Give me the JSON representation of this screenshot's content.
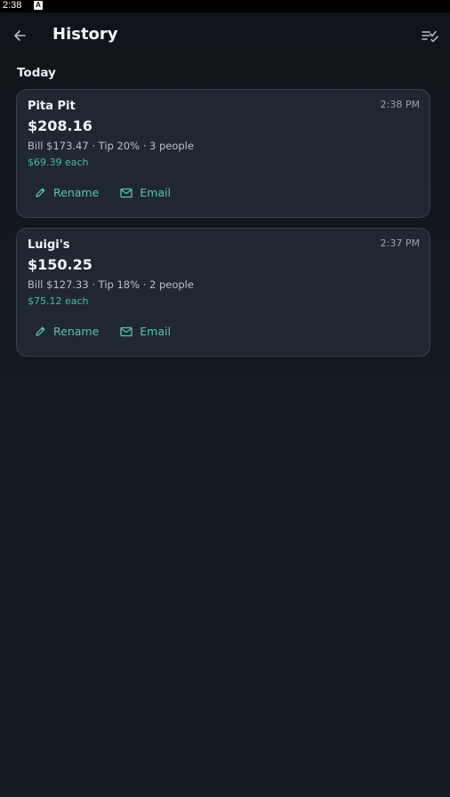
{
  "status_bar": {
    "time": "2:38",
    "notification_glyph": "A"
  },
  "app_bar": {
    "title": "History",
    "back_icon": "arrow-left-icon",
    "select_icon": "checklist-icon"
  },
  "sections": [
    {
      "label": "Today",
      "entries": [
        {
          "name": "Pita Pit",
          "time": "2:38 PM",
          "total": "$208.16",
          "details": "Bill $173.47 · Tip 20% · 3 people",
          "each": "$69.39 each",
          "actions": {
            "rename": "Rename",
            "email": "Email"
          }
        },
        {
          "name": "Luigi's",
          "time": "2:37 PM",
          "total": "$150.25",
          "details": "Bill $127.33 · Tip 18% · 2 people",
          "each": "$75.12 each",
          "actions": {
            "rename": "Rename",
            "email": "Email"
          }
        }
      ]
    }
  ],
  "colors": {
    "background": "#131a20",
    "card": "#1f2830",
    "card_border": "#36414b",
    "accent": "#5ec2ad",
    "text_primary": "#f0f3f6",
    "text_secondary": "#b7c0c8"
  }
}
